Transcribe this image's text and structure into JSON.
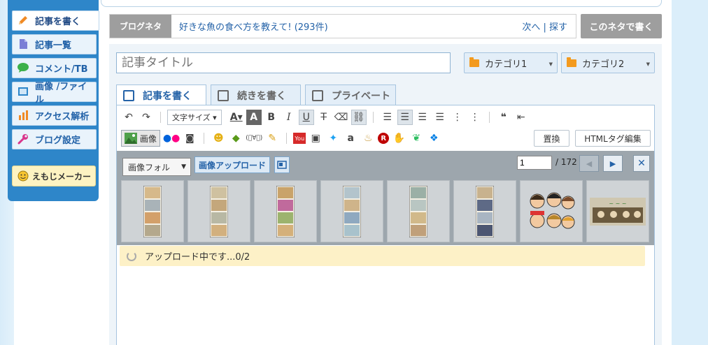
{
  "sidebar": {
    "items": [
      {
        "label": "記事を書く",
        "icon": "pencil-icon",
        "color": "#f08a24"
      },
      {
        "label": "記事一覧",
        "icon": "document-list-icon",
        "color": "#7b7fd6"
      },
      {
        "label": "コメント/TB",
        "icon": "speech-bubble-icon",
        "color": "#3cb04a"
      },
      {
        "label": "画像 /ファイル",
        "icon": "image-file-icon",
        "color": "#2e86c9"
      },
      {
        "label": "アクセス解析",
        "icon": "bar-chart-icon",
        "color": "#f08a24"
      },
      {
        "label": "ブログ設定",
        "icon": "wrench-icon",
        "color": "#d9368b"
      }
    ],
    "emoji_maker": "えもじメーカー"
  },
  "neta": {
    "label": "ブログネタ",
    "text": "好きな魚の食べ方を教えて! (293件)",
    "links": "次へ | 探す",
    "button": "このネタで書く"
  },
  "editor": {
    "title_placeholder": "記事タイトル",
    "category1": "カテゴリ1",
    "category2": "カテゴリ2",
    "tabs": [
      "記事を書く",
      "続きを書く",
      "プライベート"
    ],
    "fontsize_label": "文字サイズ",
    "image_button": "画像",
    "replace_button": "置換",
    "html_edit_button": "HTMLタグ編集"
  },
  "images": {
    "folder_select": "画像フォル",
    "upload_button": "画像アップロード",
    "page_current": "1",
    "page_total": "/ 172",
    "upload_status": "アップロード中です...0/2"
  },
  "colors": {
    "sidebar_bg": "#2e86c9",
    "link": "#2563a8",
    "status_bg": "#fdf1c7"
  }
}
